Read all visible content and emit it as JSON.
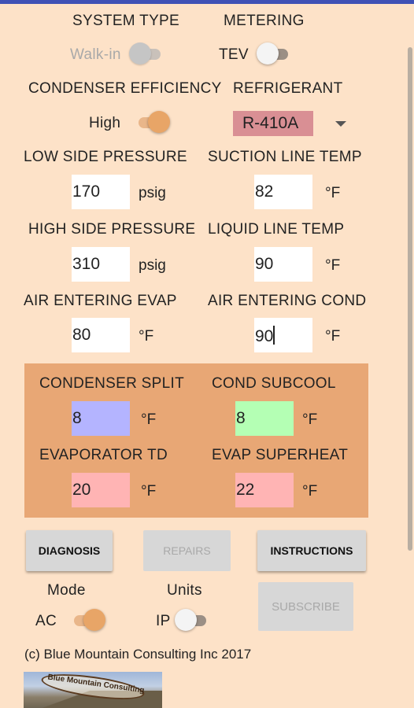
{
  "system": {
    "system_type_label": "SYSTEM TYPE",
    "system_type_value": "Walk-in",
    "metering_label": "METERING",
    "metering_value": "TEV"
  },
  "condenser": {
    "efficiency_label": "CONDENSER EFFICIENCY",
    "efficiency_value": "High",
    "refrigerant_label": "REFRIGERANT",
    "refrigerant_value": "R-410A"
  },
  "inputs": {
    "low_side_pressure": {
      "label": "LOW SIDE PRESSURE",
      "value": "170",
      "unit": "psig"
    },
    "suction_line_temp": {
      "label": "SUCTION LINE TEMP",
      "value": "82",
      "unit": "°F"
    },
    "high_side_pressure": {
      "label": "HIGH SIDE PRESSURE",
      "value": "310",
      "unit": "psig"
    },
    "liquid_line_temp": {
      "label": "LIQUID LINE TEMP",
      "value": "90",
      "unit": "°F"
    },
    "air_entering_evap": {
      "label": "AIR ENTERING EVAP",
      "value": "80",
      "unit": "°F"
    },
    "air_entering_cond": {
      "label": "AIR ENTERING COND",
      "value": "90",
      "unit": "°F"
    }
  },
  "results": {
    "condenser_split": {
      "label": "CONDENSER SPLIT",
      "value": "8",
      "unit": "°F",
      "color": "#b4b4ff"
    },
    "cond_subcool": {
      "label": "COND SUBCOOL",
      "value": "8",
      "unit": "°F",
      "color": "#b4ffb4"
    },
    "evaporator_td": {
      "label": "EVAPORATOR TD",
      "value": "20",
      "unit": "°F",
      "color": "#ffb4b4"
    },
    "evap_superheat": {
      "label": "EVAP SUPERHEAT",
      "value": "22",
      "unit": "°F",
      "color": "#ffb4b4"
    }
  },
  "buttons": {
    "diagnosis": "DIAGNOSIS",
    "repairs": "REPAIRS",
    "instructions": "INSTRUCTIONS",
    "subscribe": "SUBSCRIBE"
  },
  "mode": {
    "label": "Mode",
    "value": "AC"
  },
  "units": {
    "label": "Units",
    "value": "IP"
  },
  "footer": {
    "copyright": "(c) Blue Mountain Consulting Inc 2017",
    "logo_text": "Blue Mountain Consulting"
  },
  "colors": {
    "background": "#fde2c8",
    "results_panel": "#e8a775",
    "refrigerant_select": "#d98f94",
    "toggle_on": "#e8a567"
  }
}
